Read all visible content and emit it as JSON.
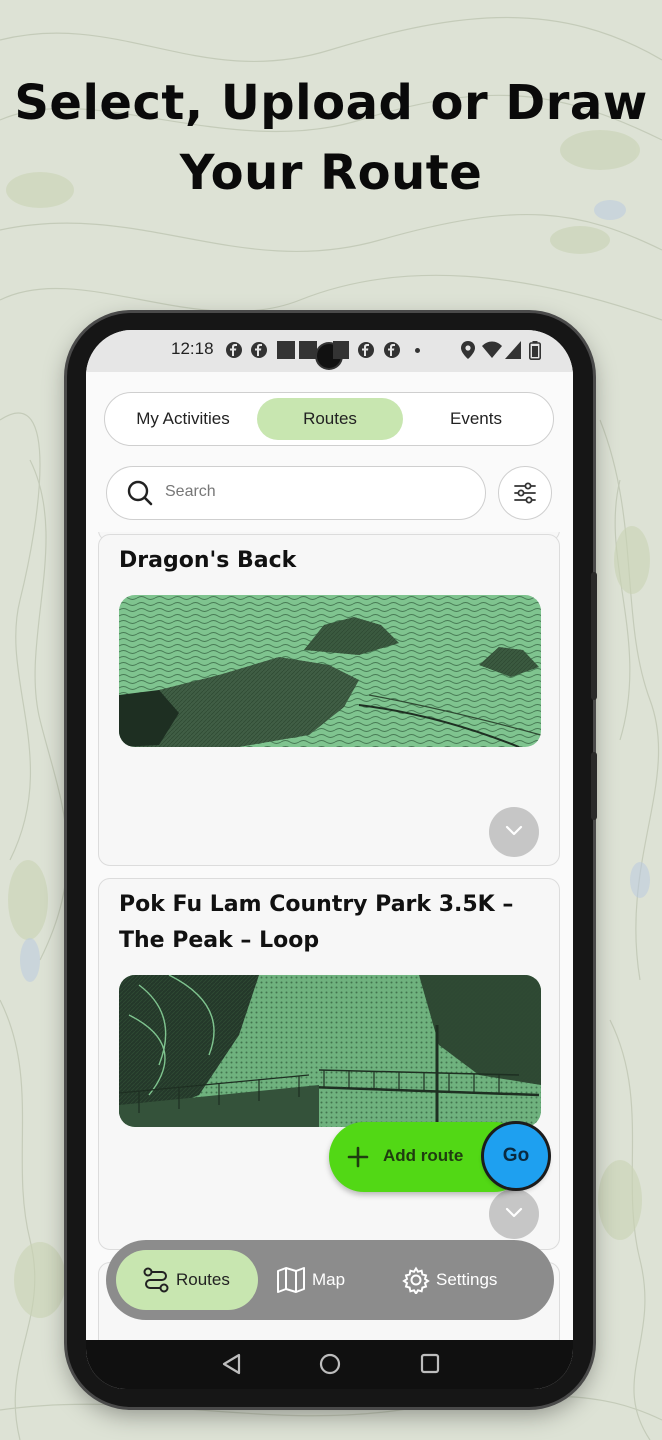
{
  "headline": {
    "line1": "Select, Upload or Draw",
    "line2": "Your Route"
  },
  "status_bar": {
    "time": "12:18"
  },
  "tabs": [
    {
      "label": "My Activities",
      "active": false
    },
    {
      "label": "Routes",
      "active": true
    },
    {
      "label": "Events",
      "active": false
    }
  ],
  "search": {
    "placeholder": "Search"
  },
  "routes": [
    {
      "title": "Dragon's Back"
    },
    {
      "title_line1": "Pok Fu Lam Country Park 3.5K –",
      "title_line2": "The Peak – Loop"
    }
  ],
  "fab": {
    "add_label": "Add route",
    "go_label": "Go"
  },
  "bottom_nav": [
    {
      "label": "Routes",
      "icon": "route-icon",
      "active": true
    },
    {
      "label": "Map",
      "icon": "map-icon",
      "active": false
    },
    {
      "label": "Settings",
      "icon": "gear-icon",
      "active": false
    }
  ],
  "colors": {
    "accent_light": "#c8e6b0",
    "add_route_green": "#52d815",
    "go_blue": "#1ea0f0",
    "image_tint": "#7fc48f"
  }
}
